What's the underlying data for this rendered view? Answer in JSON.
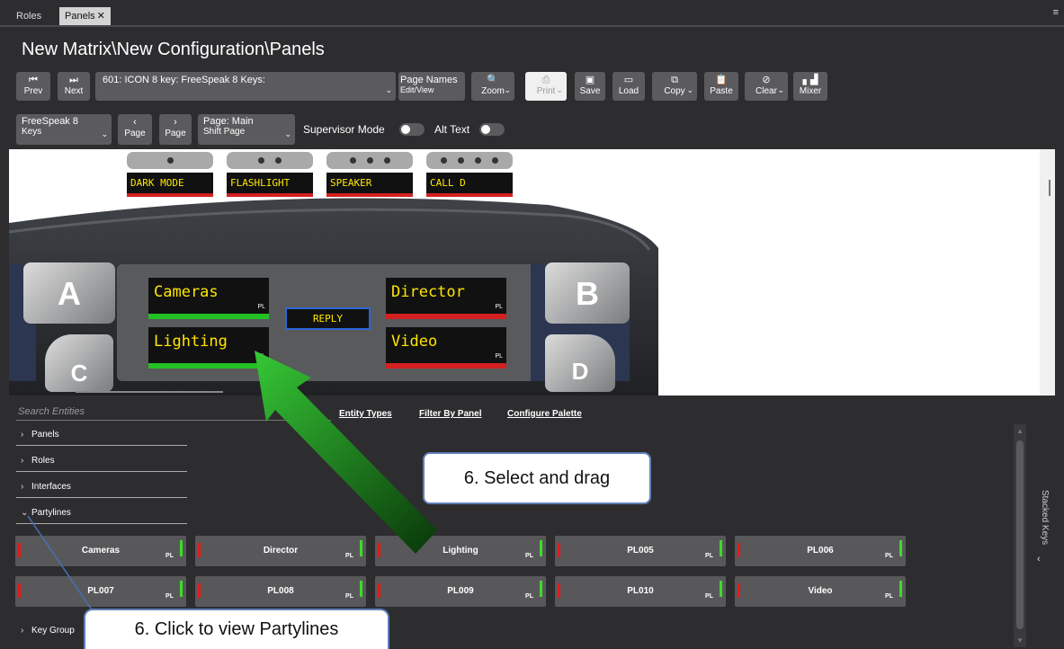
{
  "tabs": [
    {
      "label": "Roles"
    },
    {
      "label": "Panels",
      "close": "✕"
    }
  ],
  "page_title": "New Matrix\\New Configuration\\Panels",
  "toolbar": {
    "prev": "Prev",
    "next": "Next",
    "panel_select": "601: ICON 8 key:  FreeSpeak 8 Keys:",
    "page_names_line1": "Page Names",
    "page_names_line2": "Edit/View",
    "zoom": "Zoom",
    "print": "Print",
    "save": "Save",
    "load": "Load",
    "copy": "Copy",
    "paste": "Paste",
    "clear": "Clear",
    "mixer": "Mixer"
  },
  "toolbar2": {
    "keyset_line1": "FreeSpeak 8",
    "keyset_line2": "Keys",
    "page_prev": "Page",
    "page_next": "Page",
    "page_line1": "Page: Main",
    "page_line2": "Shift Page",
    "supervisor_mode": "Supervisor Mode",
    "alt_text": "Alt Text"
  },
  "top_keys": [
    {
      "label": "DARK MODE",
      "dots": 1
    },
    {
      "label": "FLASHLIGHT",
      "dots": 2
    },
    {
      "label": "SPEAKER",
      "dots": 3
    },
    {
      "label": "CALL D",
      "dots": 4
    }
  ],
  "device": {
    "button_a": "A",
    "button_b": "B",
    "button_c": "C",
    "button_d": "D",
    "reply": "REPLY",
    "keys": [
      {
        "name": "Cameras",
        "tag": "PL",
        "status": "#23c023"
      },
      {
        "name": "Director",
        "tag": "PL",
        "status": "#d42020"
      },
      {
        "name": "Lighting",
        "tag": "PL",
        "status": "#23c023"
      },
      {
        "name": "Video",
        "tag": "PL",
        "status": "#d42020"
      }
    ]
  },
  "entity_browser": {
    "search_placeholder": "Search Entities",
    "links": [
      "Entity Types",
      "Filter By Panel",
      "Configure Palette"
    ],
    "categories": [
      "Panels",
      "Roles",
      "Interfaces",
      "Partylines",
      "Key Group"
    ],
    "partylines": [
      {
        "name": "Cameras",
        "tag": "PL"
      },
      {
        "name": "Director",
        "tag": "PL"
      },
      {
        "name": "Lighting",
        "tag": "PL"
      },
      {
        "name": "PL005",
        "tag": "PL"
      },
      {
        "name": "PL006",
        "tag": "PL"
      },
      {
        "name": "PL007",
        "tag": "PL"
      },
      {
        "name": "PL008",
        "tag": "PL"
      },
      {
        "name": "PL009",
        "tag": "PL"
      },
      {
        "name": "PL010",
        "tag": "PL"
      },
      {
        "name": "Video",
        "tag": "PL"
      }
    ],
    "stacked_keys": "Stacked Keys"
  },
  "callouts": {
    "drag": "6. Select and drag",
    "click": "6. Click to view Partylines"
  },
  "colors": {
    "accent_blue": "#2c66d8",
    "status_red": "#e21a1a",
    "status_green": "#3ddc28",
    "arrow_green": "#2db82d"
  }
}
